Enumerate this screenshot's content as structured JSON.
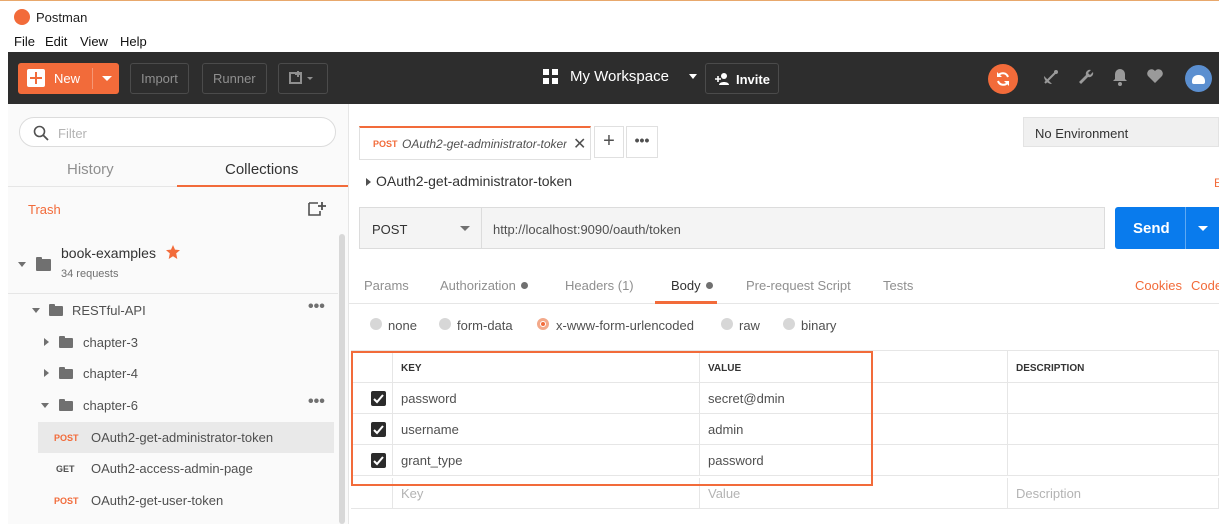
{
  "window": {
    "title": "Postman"
  },
  "menu": [
    "File",
    "Edit",
    "View",
    "Help"
  ],
  "header": {
    "new_label": "New",
    "import_label": "Import",
    "runner_label": "Runner",
    "workspace_label": "My Workspace",
    "invite_label": "Invite",
    "accent": "#f26b3a"
  },
  "sidebar": {
    "filter_placeholder": "Filter",
    "tabs": [
      "History",
      "Collections"
    ],
    "active_tab": "Collections",
    "trash_label": "Trash",
    "collection": {
      "name": "book-examples",
      "count": "34 requests"
    },
    "folders": [
      "RESTful-API",
      "chapter-3",
      "chapter-4",
      "chapter-6"
    ],
    "requests": [
      {
        "method": "POST",
        "name": "OAuth2-get-administrator-token",
        "color": "#f26b3a"
      },
      {
        "method": "GET",
        "name": "OAuth2-access-admin-page",
        "color": "#505050"
      },
      {
        "method": "POST",
        "name": "OAuth2-get-user-token",
        "color": "#f26b3a"
      }
    ]
  },
  "tab": {
    "method": "POST",
    "name": "OAuth2-get-administrator-token"
  },
  "environment": "No Environment",
  "request": {
    "name": "OAuth2-get-administrator-token",
    "method": "POST",
    "url": "http://localhost:9090/oauth/token",
    "send_label": "Send",
    "send_color": "#097bed"
  },
  "request_tabs": {
    "params": "Params",
    "authorization": "Authorization",
    "headers": "Headers (1)",
    "body": "Body",
    "prerequest": "Pre-request Script",
    "tests": "Tests",
    "cookies": "Cookies",
    "code": "Code"
  },
  "body_types": [
    "none",
    "form-data",
    "x-www-form-urlencoded",
    "raw",
    "binary"
  ],
  "selected_body_type": "x-www-form-urlencoded",
  "table": {
    "headers": [
      "KEY",
      "VALUE",
      "DESCRIPTION"
    ],
    "rows": [
      {
        "key": "password",
        "value": "secret@dmin",
        "checked": true
      },
      {
        "key": "username",
        "value": "admin",
        "checked": true
      },
      {
        "key": "grant_type",
        "value": "password",
        "checked": true
      }
    ],
    "placeholders": {
      "key": "Key",
      "value": "Value",
      "description": "Description"
    }
  }
}
